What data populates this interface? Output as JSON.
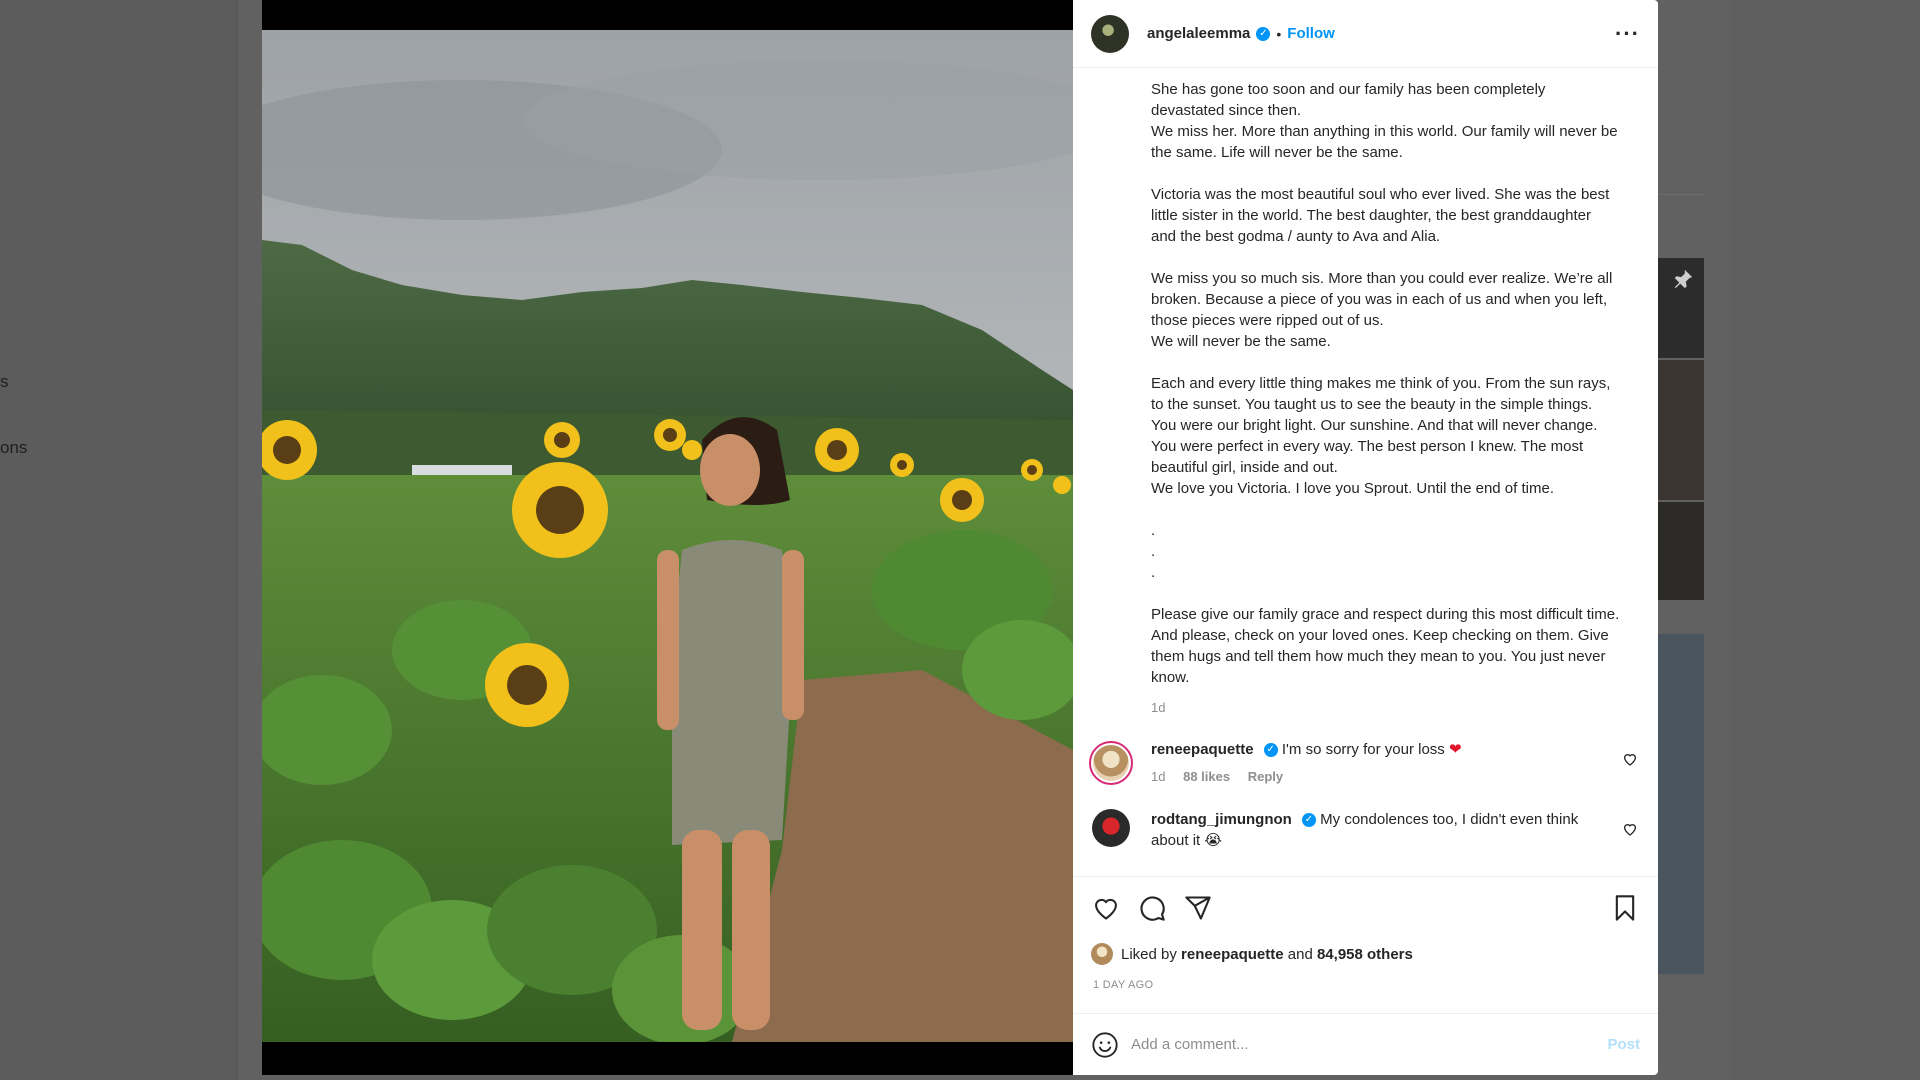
{
  "background": {
    "sidebar_fragments": [
      "s",
      "ons"
    ]
  },
  "post": {
    "username": "angelaleemma",
    "follow_label": "Follow",
    "separator": "•",
    "more_icon": "more-horizontal-icon",
    "caption": "She has gone too soon and our family has been completely devastated since then.\nWe miss her. More than anything in this world. Our family will never be the same. Life will never be the same.\n\nVictoria was the most beautiful soul who ever lived. She was the best little sister in the world. The best daughter, the best granddaughter and the best godma / aunty to Ava and Alia.\n\nWe miss you so much sis. More than you could ever realize. We’re all broken. Because a piece of you was in each of us and when you left, those pieces were ripped out of us.\nWe will never be the same.\n\nEach and every little thing makes me think of you. From the sun rays, to the sunset. You taught us to see the beauty in the simple things. You were our bright light. Our sunshine. And that will never change. You were perfect in every way. The best person I knew. The most beautiful girl, inside and out.\nWe love you Victoria. I love you Sprout. Until the end of time.\n\n.\n.\n.\n\nPlease give our family grace and respect during this most difficult time. And please, check on your loved ones. Keep checking on them. Give them hugs and tell them how much they mean to you. You just never know.",
    "caption_time": "1d"
  },
  "comments": [
    {
      "username": "reneepaquette",
      "text": "I'm so sorry for your loss",
      "emoji": "❤",
      "time": "1d",
      "likes": "88 likes",
      "reply": "Reply"
    },
    {
      "username": "rodtang_jimungnon",
      "text": "My condolences too, I didn't even think about it",
      "emoji": "😭"
    }
  ],
  "actions": {
    "liked_by_prefix": "Liked by",
    "liked_by_user": "reneepaquette",
    "liked_by_and": "and",
    "liked_by_others": "84,958 others",
    "time_ago": "1 DAY AGO"
  },
  "comment_box": {
    "placeholder": "Add a comment...",
    "post_label": "Post"
  },
  "colors": {
    "accent": "#0095f6",
    "post_disabled": "#b2dffc",
    "heart": "#e0162b"
  }
}
